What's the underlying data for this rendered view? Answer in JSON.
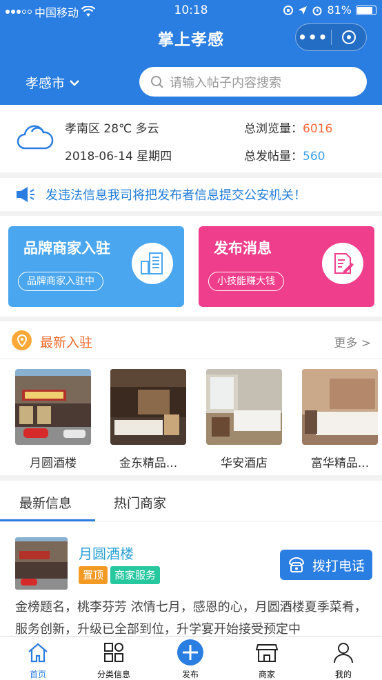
{
  "status": {
    "carrier": "中国移动",
    "time": "10:18",
    "battery": "81%"
  },
  "header": {
    "title": "掌上孝感",
    "city": "孝感市",
    "search_placeholder": "请输入帖子内容搜索"
  },
  "weather": {
    "location": "孝南区",
    "temp": "28℃",
    "condition": "多云",
    "date": "2018-06-14",
    "weekday": "星期四",
    "views_label": "总浏览量：",
    "views": "6016",
    "posts_label": "总发帖量：",
    "posts": "560"
  },
  "notice": {
    "text": "发违法信息我司将把发布者信息提交公安机关！"
  },
  "cards": [
    {
      "title": "品牌商家入驻",
      "tag": "品牌商家入驻中",
      "color": "#4aa6ef",
      "icon": "building-icon"
    },
    {
      "title": "发布消息",
      "tag": "小技能赚大钱",
      "color": "#ef3e8b",
      "icon": "edit-icon"
    }
  ],
  "new_section": {
    "title": "最新入驻",
    "more": "更多 >"
  },
  "shops": [
    {
      "name": "月圆酒楼"
    },
    {
      "name": "金东精品..."
    },
    {
      "name": "华安酒店"
    },
    {
      "name": "富华精品..."
    }
  ],
  "list_tabs": [
    "最新信息",
    "热门商家"
  ],
  "item": {
    "name": "月圆酒楼",
    "badge1": "置顶",
    "badge2": "商家服务",
    "call": "拨打电话",
    "desc": "金榜题名，桃李芬芳 浓情七月，感恩的心，月圆酒楼夏季菜肴，服务创新，升级已全部到位，升学宴开始接受预定中"
  },
  "tabbar": [
    "首页",
    "分类信息",
    "发布",
    "商家",
    "我的"
  ],
  "colors": {
    "primary": "#2a7de1",
    "accent_orange": "#ee6a2b",
    "pink": "#ef3e8b",
    "light_blue": "#4aa6ef"
  }
}
